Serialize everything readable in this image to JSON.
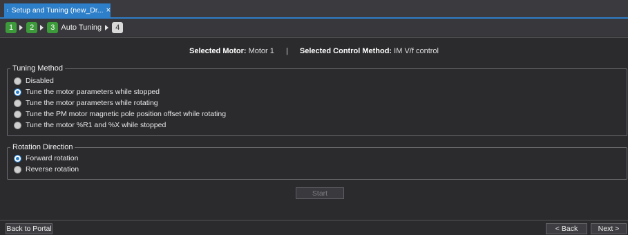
{
  "tab": {
    "title": "Setup and Tuning (new_Dr...",
    "close": "×"
  },
  "steps": [
    {
      "number": "1",
      "label": ""
    },
    {
      "number": "2",
      "label": ""
    },
    {
      "number": "3",
      "label": "Auto Tuning"
    },
    {
      "number": "4",
      "label": ""
    }
  ],
  "info": {
    "motor_label": "Selected Motor:",
    "motor_value": "Motor 1",
    "separator": "|",
    "method_label": "Selected Control Method:",
    "method_value": "IM V/f control"
  },
  "tuning_method": {
    "title": "Tuning Method",
    "options": [
      {
        "label": "Disabled",
        "checked": false
      },
      {
        "label": "Tune the motor parameters while stopped",
        "checked": true
      },
      {
        "label": "Tune the motor parameters while rotating",
        "checked": false
      },
      {
        "label": "Tune the PM motor magnetic pole position offset while rotating",
        "checked": false
      },
      {
        "label": "Tune the motor %R1 and %X while stopped",
        "checked": false
      }
    ]
  },
  "rotation_direction": {
    "title": "Rotation Direction",
    "options": [
      {
        "label": "Forward rotation",
        "checked": true
      },
      {
        "label": "Reverse rotation",
        "checked": false
      }
    ]
  },
  "buttons": {
    "start": "Start",
    "back_to_portal": "Back to Portal",
    "back": "< Back",
    "next": "Next >"
  },
  "colors": {
    "accent": "#2d7fc9",
    "step_green": "#3d9a3a",
    "background": "#2b2b2e"
  }
}
